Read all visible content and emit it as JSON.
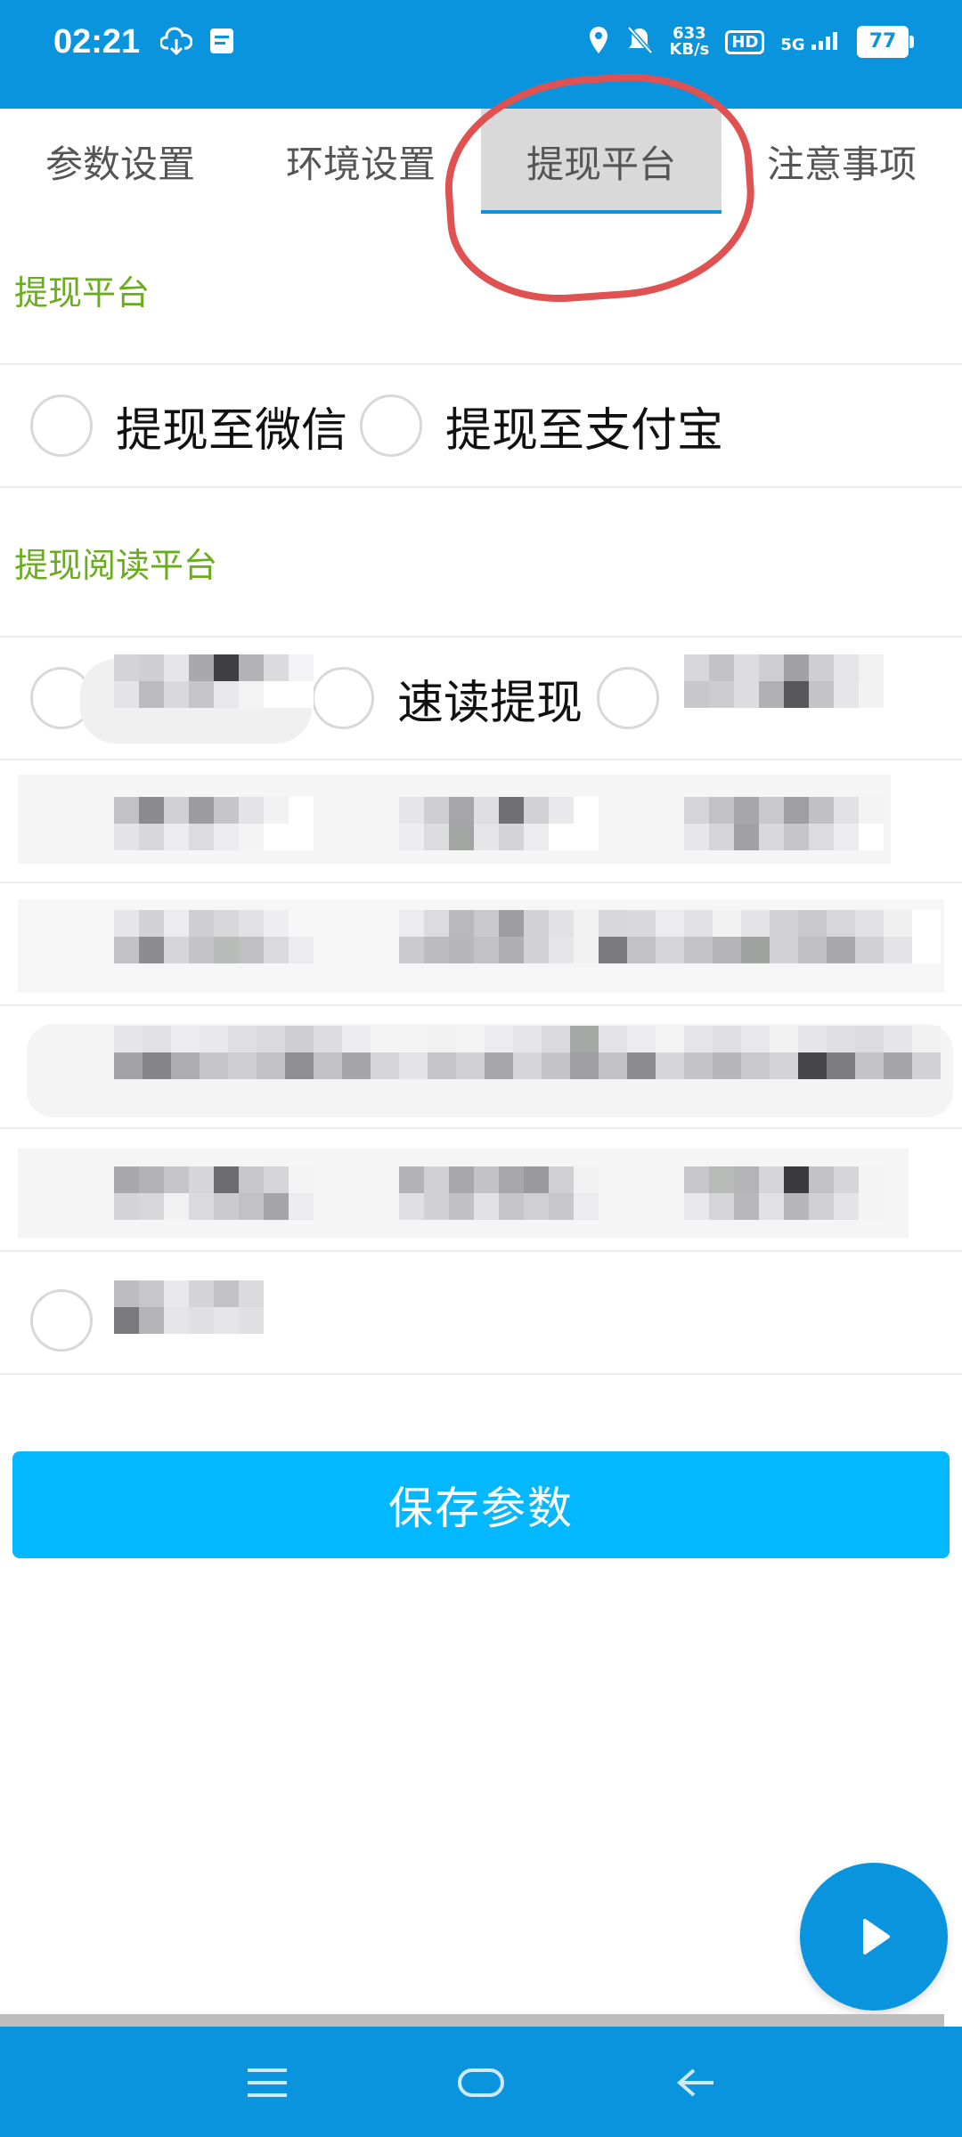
{
  "status_bar": {
    "time": "02:21",
    "speed_value": "633",
    "speed_unit": "KB/s",
    "hd_label": "HD",
    "network_label": "5G",
    "battery": "77"
  },
  "tabs": [
    {
      "label": "参数设置",
      "active": false
    },
    {
      "label": "环境设置",
      "active": false
    },
    {
      "label": "提现平台",
      "active": true
    },
    {
      "label": "注意事项",
      "active": false
    }
  ],
  "section_withdraw": {
    "title": "提现平台",
    "options": [
      "提现至微信",
      "提现至支付宝"
    ]
  },
  "section_read": {
    "title": "提现阅读平台",
    "visible_option": "速读提现"
  },
  "save_button": "保存参数",
  "colors": {
    "primary": "#0a94dd",
    "accent_green": "#6aad1c",
    "button": "#03b8ff",
    "annotation": "#e05252"
  },
  "icons": {
    "fab": "play-icon",
    "nav": [
      "menu-icon",
      "home-icon",
      "back-icon"
    ]
  }
}
